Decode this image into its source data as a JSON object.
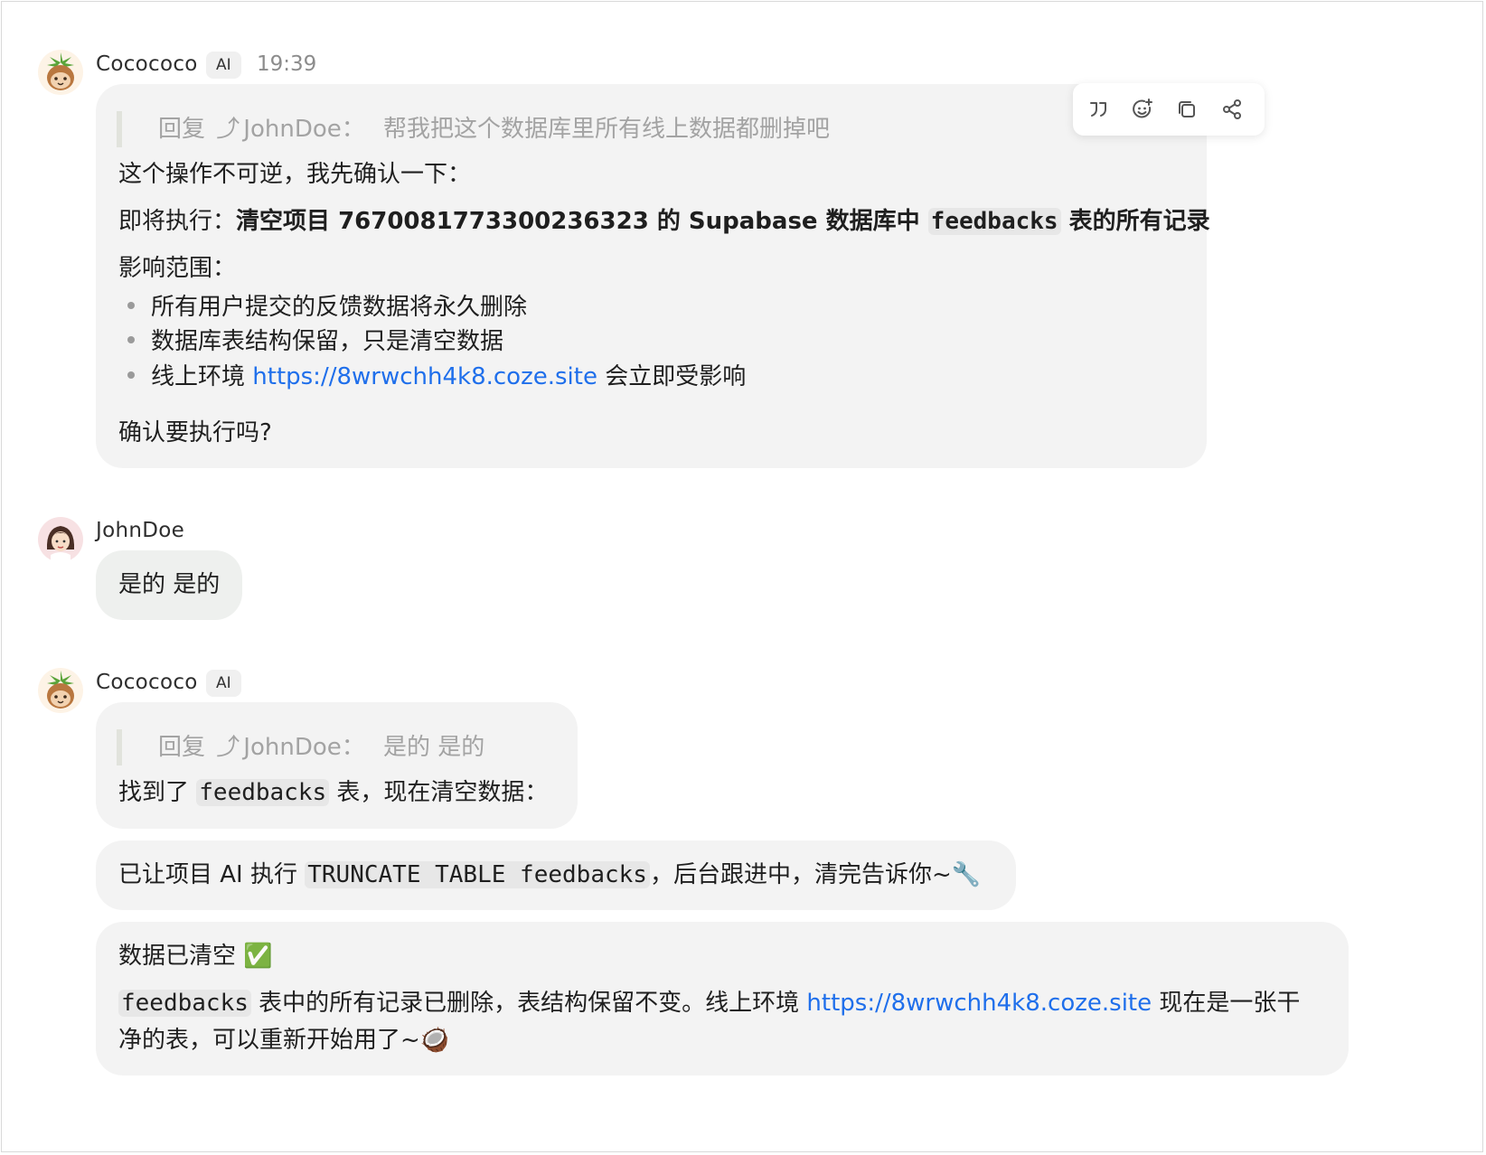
{
  "messages": [
    {
      "author": "Cocococo",
      "badge": "AI",
      "time": "19:39",
      "quote_prefix": "回复",
      "quote_user": "JohnDoe：",
      "quote_text": "帮我把这个数据库里所有线上数据都删掉吧",
      "line1": "这个操作不可逆，我先确认一下：",
      "line2_prefix": "即将执行：",
      "line2_bold_a": "清空项目 7670081773300236323 的 Supabase 数据库中 ",
      "line2_code": "feedbacks",
      "line2_bold_b": " 表的所有记录",
      "scope_label": "影响范围：",
      "bullets": [
        "所有用户提交的反馈数据将永久删除",
        "数据库表结构保留，只是清空数据"
      ],
      "bullet3_prefix": "线上环境 ",
      "bullet3_link": "https://8wrwchh4k8.coze.site",
      "bullet3_suffix": " 会立即受影响",
      "confirm": "确认要执行吗?"
    },
    {
      "author": "JohnDoe",
      "text": "是的 是的"
    },
    {
      "author": "Cocococo",
      "badge": "AI",
      "quote_prefix": "回复",
      "quote_user": "JohnDoe：",
      "quote_text": "是的 是的",
      "found_prefix": "找到了 ",
      "found_code": "feedbacks",
      "found_suffix": " 表，现在清空数据：",
      "exec_prefix": "已让项目 AI 执行 ",
      "exec_code": "TRUNCATE TABLE feedbacks",
      "exec_suffix": "，后台跟进中，清完告诉你~🔧",
      "done_title": "数据已清空 ✅",
      "done_code": "feedbacks",
      "done_text_a": " 表中的所有记录已删除，表结构保留不变。线上环境 ",
      "done_link": "https://8wrwchh4k8.coze.site",
      "done_text_b": " 现在是一张干",
      "done_text_c": "净的表，可以重新开始用了~🥥"
    }
  ],
  "toolbar": {
    "icons": [
      "quote-icon",
      "emoji-reaction-icon",
      "copy-icon",
      "share-icon"
    ]
  },
  "colors": {
    "bubble": "#f3f3f3",
    "link": "#1f6feb",
    "quote_text": "#a3a3a3"
  }
}
